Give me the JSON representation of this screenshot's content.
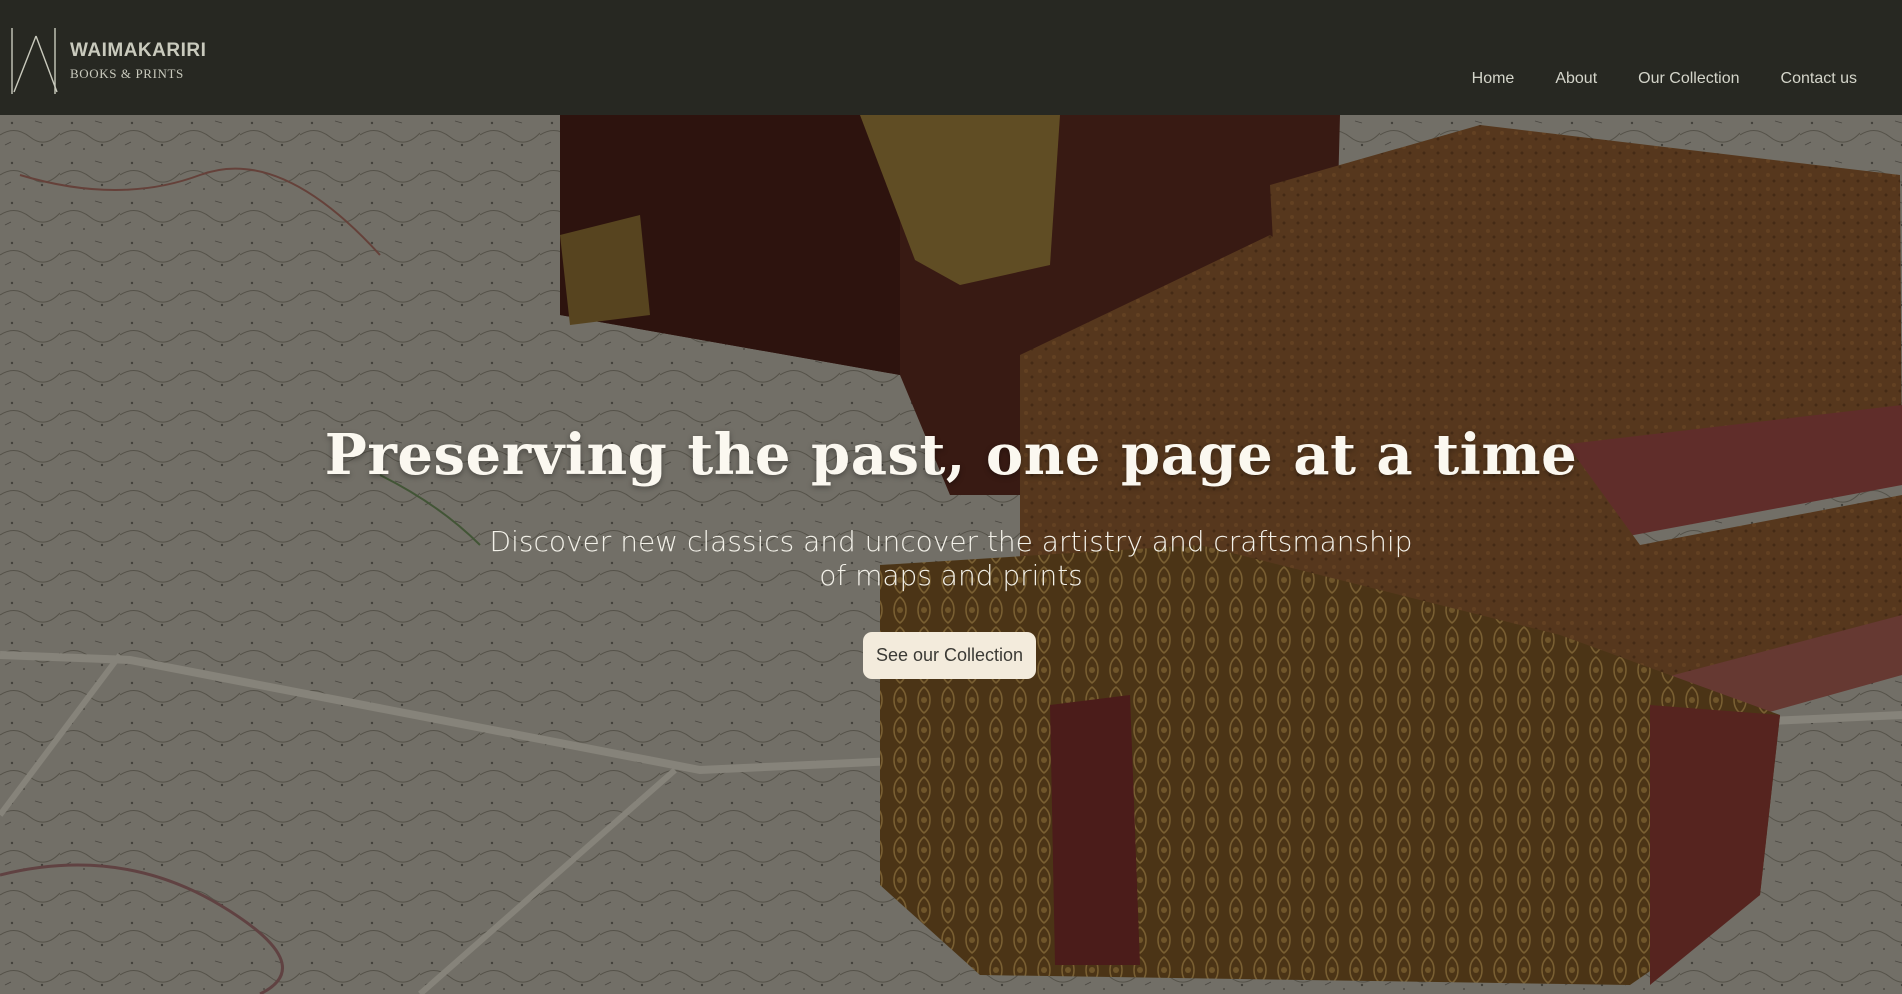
{
  "brand": {
    "title": "WAIMAKARIRI",
    "subtitle": "BOOKS & PRINTS"
  },
  "nav": {
    "items": [
      {
        "label": "Home"
      },
      {
        "label": "About"
      },
      {
        "label": "Our Collection"
      },
      {
        "label": "Contact us"
      }
    ]
  },
  "hero": {
    "headline": "Preserving the past, one page at a time",
    "subtext_line1": "Discover new classics and uncover the artistry and craftsmanship",
    "subtext_line2": "of maps and prints",
    "cta_label": "See our Collection",
    "background_image": "antique books and wooden chest on old map"
  },
  "colors": {
    "navbar_bg": "#272822",
    "nav_text": "#d4d5ca",
    "cta_bg": "#f3ebdc",
    "headline": "#fbf8f0"
  }
}
